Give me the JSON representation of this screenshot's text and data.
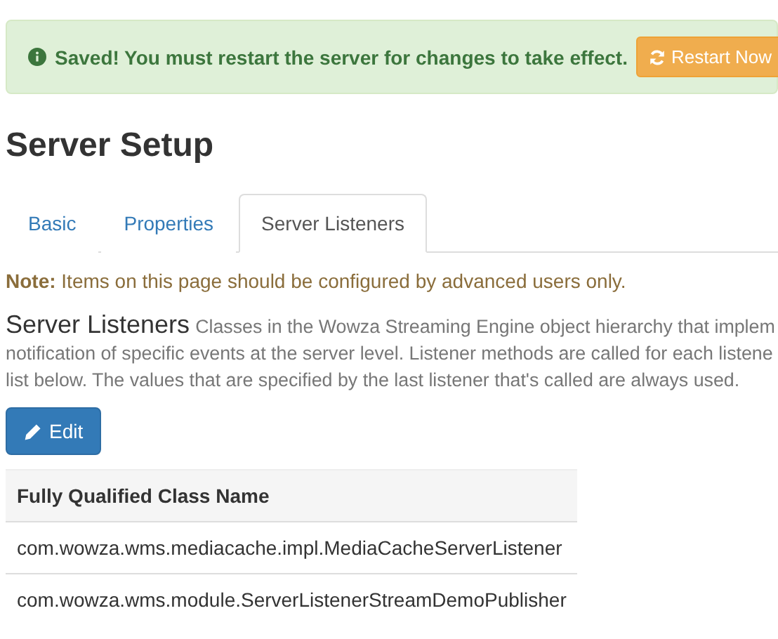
{
  "alert": {
    "message": "Saved! You must restart the server for changes to take effect.",
    "button": "Restart Now"
  },
  "page_title": "Server Setup",
  "tabs": [
    {
      "label": "Basic",
      "selected": false
    },
    {
      "label": "Properties",
      "selected": false
    },
    {
      "label": "Server Listeners",
      "selected": true
    }
  ],
  "note": {
    "label": "Note:",
    "text": "Items on this page should be configured by advanced users only."
  },
  "section": {
    "heading": "Server Listeners",
    "description_lines": [
      "Classes in the Wowza Streaming Engine object hierarchy that implem",
      "notification of specific events at the server level. Listener methods are called for each listene",
      "list below. The values that are specified by the last listener that's called are always used."
    ]
  },
  "edit_button": "Edit",
  "table": {
    "columns": [
      "Fully Qualified Class Name"
    ],
    "rows": [
      [
        "com.wowza.wms.mediacache.impl.MediaCacheServerListener"
      ],
      [
        "com.wowza.wms.module.ServerListenerStreamDemoPublisher"
      ]
    ]
  }
}
